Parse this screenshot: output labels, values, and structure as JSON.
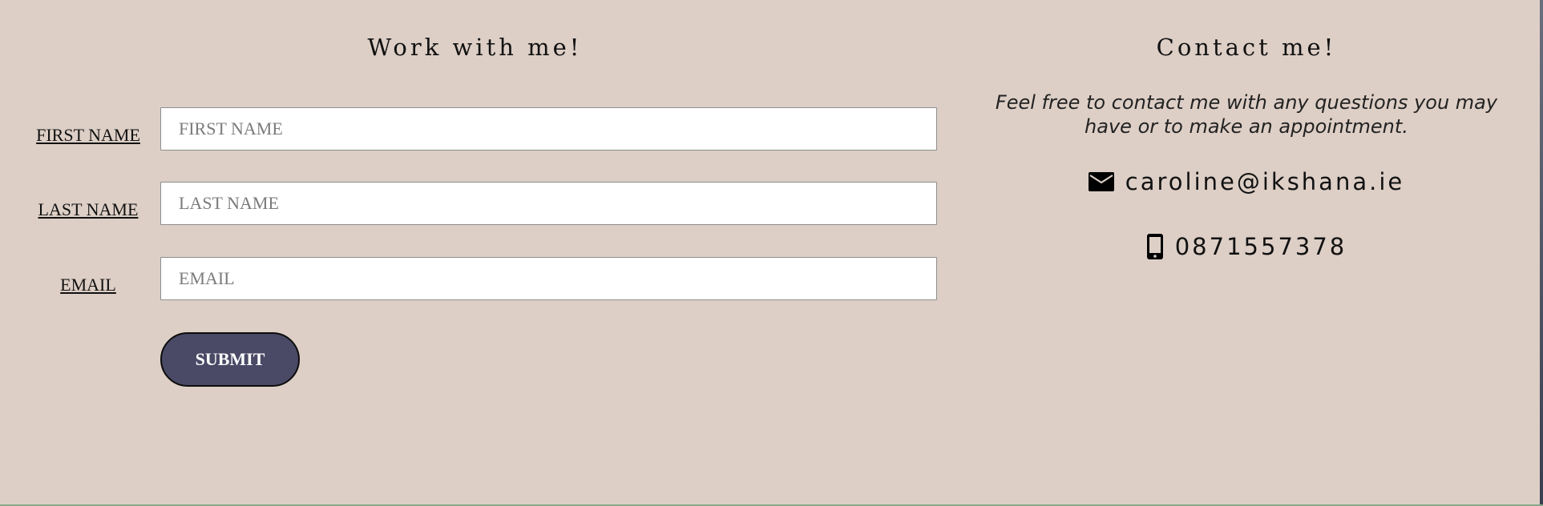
{
  "work_section": {
    "title": "Work with me!",
    "fields": [
      {
        "label": "FIRST NAME",
        "placeholder": "FIRST NAME",
        "value": ""
      },
      {
        "label": "LAST NAME",
        "placeholder": "LAST NAME",
        "value": ""
      },
      {
        "label": "EMAIL",
        "placeholder": "EMAIL",
        "value": ""
      }
    ],
    "submit_label": "SUBMIT"
  },
  "contact_section": {
    "title": "Contact me!",
    "text": "Feel free to contact me with any questions you may have or to make an appointment.",
    "email": "caroline@ikshana.ie",
    "phone": "0871557378",
    "icons": {
      "email": "envelope-icon",
      "phone": "mobile-phone-icon"
    }
  },
  "colors": {
    "background": "#ddcfc6",
    "button": "#4a4966",
    "button_text": "#ffffff"
  }
}
